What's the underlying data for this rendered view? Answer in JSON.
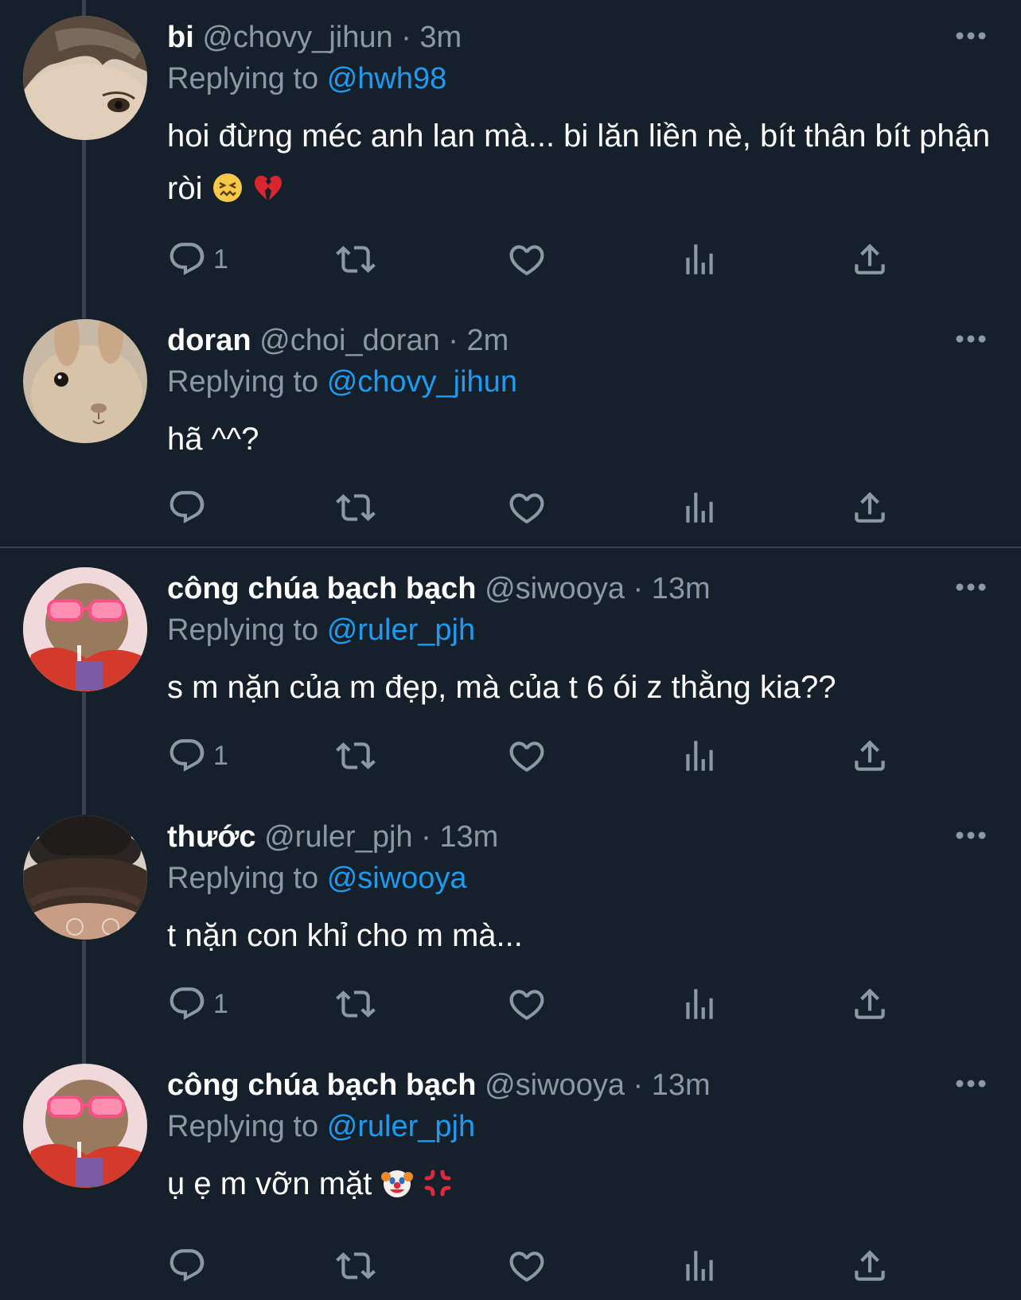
{
  "tweets": [
    {
      "name": "bi",
      "handle": "@chovy_jihun",
      "sep": "·",
      "time": "3m",
      "replying_prefix": "Replying to",
      "replying_to": "@hwh98",
      "text": "hoi đừng méc anh lan mà... bi lăn liền nè, bít thân bít phận ròi",
      "emojis": [
        "confounded-face-emoji",
        "broken-heart-emoji"
      ],
      "reply_count": "1",
      "retweet_count": "",
      "like_count": ""
    },
    {
      "name": "doran",
      "handle": "@choi_doran",
      "sep": "·",
      "time": "2m",
      "replying_prefix": "Replying to",
      "replying_to": "@chovy_jihun",
      "text": "hã ^^?",
      "emojis": [],
      "reply_count": "",
      "retweet_count": "",
      "like_count": ""
    },
    {
      "name": "công chúa bạch bạch",
      "handle": "@siwooya",
      "sep": "·",
      "time": "13m",
      "replying_prefix": "Replying to",
      "replying_to": "@ruler_pjh",
      "text": "s m nặn của m đẹp, mà của t 6 ói z thằng kia??",
      "emojis": [],
      "reply_count": "1",
      "retweet_count": "",
      "like_count": ""
    },
    {
      "name": "thước",
      "handle": "@ruler_pjh",
      "sep": "·",
      "time": "13m",
      "replying_prefix": "Replying to",
      "replying_to": "@siwooya",
      "text": "t nặn con khỉ cho m mà...",
      "emojis": [],
      "reply_count": "1",
      "retweet_count": "",
      "like_count": ""
    },
    {
      "name": "công chúa bạch bạch",
      "handle": "@siwooya",
      "sep": "·",
      "time": "13m",
      "replying_prefix": "Replying to",
      "replying_to": "@ruler_pjh",
      "text": "ụ ẹ m vỡn mặt",
      "emojis": [
        "clown-face-emoji",
        "anger-symbol-emoji"
      ],
      "reply_count": "",
      "retweet_count": "",
      "like_count": ""
    }
  ],
  "icons": {
    "reply": "reply-icon",
    "retweet": "retweet-icon",
    "like": "heart-icon",
    "views": "views-icon",
    "share": "share-icon",
    "more": "more-icon"
  },
  "colors": {
    "background": "#15202b",
    "muted": "#8b98a5",
    "mention": "#1d9bf0",
    "divider": "#38444d"
  }
}
